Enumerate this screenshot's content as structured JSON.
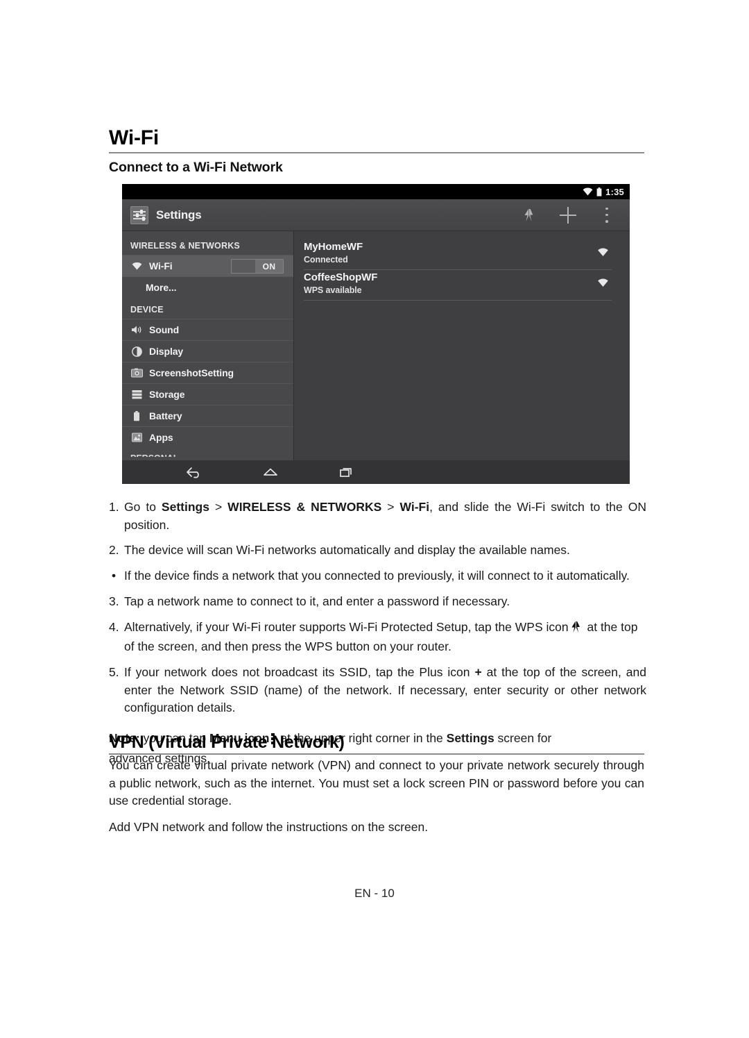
{
  "page": {
    "heading": "Wi-Fi",
    "subheading": "Connect to a Wi-Fi Network",
    "footer": "EN - 10"
  },
  "device_screenshot": {
    "status_bar": {
      "time": "1:35",
      "wifi_icon": "wifi-icon",
      "battery_icon": "battery-icon"
    },
    "action_bar": {
      "app_icon": "settings-sliders-icon",
      "title": "Settings",
      "actions": [
        {
          "name": "wps-icon",
          "label": "WPS"
        },
        {
          "name": "add-network-icon",
          "label": "+"
        },
        {
          "name": "overflow-menu-icon",
          "label": "Menu"
        }
      ]
    },
    "sidebar": {
      "section_wireless": "WIRELESS & NETWORKS",
      "section_device": "DEVICE",
      "section_personal_cut": "PERSONAL",
      "wifi_row": {
        "label": "Wi-Fi",
        "toggle_state": "ON"
      },
      "more_label": "More...",
      "device_items": [
        {
          "icon": "sound-icon",
          "label": "Sound"
        },
        {
          "icon": "display-icon",
          "label": "Display"
        },
        {
          "icon": "screenshot-icon",
          "label": "ScreenshotSetting"
        },
        {
          "icon": "storage-icon",
          "label": "Storage"
        },
        {
          "icon": "battery-icon",
          "label": "Battery"
        },
        {
          "icon": "apps-icon",
          "label": "Apps"
        }
      ]
    },
    "networks": [
      {
        "name": "MyHomeWF",
        "status": "Connected",
        "signal_icon": "wifi-signal-icon"
      },
      {
        "name": "CoffeeShopWF",
        "status": "WPS available",
        "signal_icon": "wifi-signal-icon"
      }
    ],
    "nav_bar": [
      {
        "name": "back-icon",
        "label": "Back"
      },
      {
        "name": "home-icon",
        "label": "Home"
      },
      {
        "name": "recent-apps-icon",
        "label": "Recent apps"
      }
    ]
  },
  "steps": {
    "s1": {
      "marker": "1.",
      "a": "Go to ",
      "b1": "Settings",
      "c": " > ",
      "b2": "WIRELESS & NETWORKS",
      "d": " > ",
      "b3": "Wi-Fi",
      "e": ", and slide the Wi-Fi switch to the ON position."
    },
    "s2": {
      "marker": "2.",
      "text": "The device will scan Wi-Fi networks automatically and display the available names."
    },
    "s3": {
      "marker": "•",
      "text": "If the device finds a network that you connected to previously, it will connect to it automatically."
    },
    "s4": {
      "marker": "3.",
      "text": "Tap a network name to connect to it, and enter a password if necessary."
    },
    "s5": {
      "marker": "4.",
      "a": "Alternatively, if your Wi-Fi router supports Wi-Fi Protected Setup, tap the WPS icon",
      "b": "at the top of the screen, and then press the WPS button on your router."
    },
    "s6": {
      "marker": "5.",
      "a": "If your network does not broadcast its SSID, tap the Plus icon ",
      "plus": "+",
      "b": " at the top of the screen, and enter the Network SSID (name) of the network. If necessary, enter security or other network configuration details."
    }
  },
  "note": {
    "label": "Note:",
    "a": " you can tap ",
    "b1": "Menu icon",
    "b": " at the upper right corner in the ",
    "b2": "Settings",
    "c": " screen for",
    "d": "advanced settings."
  },
  "vpn": {
    "heading": "VPN (Virtual Private Network)",
    "p1": "You can create virtual private network (VPN) and connect to your private network securely through a public network, such as the internet. You must set a lock screen PIN or password before you can use credential storage.",
    "p2": "Add VPN network and follow the instructions on the screen."
  }
}
